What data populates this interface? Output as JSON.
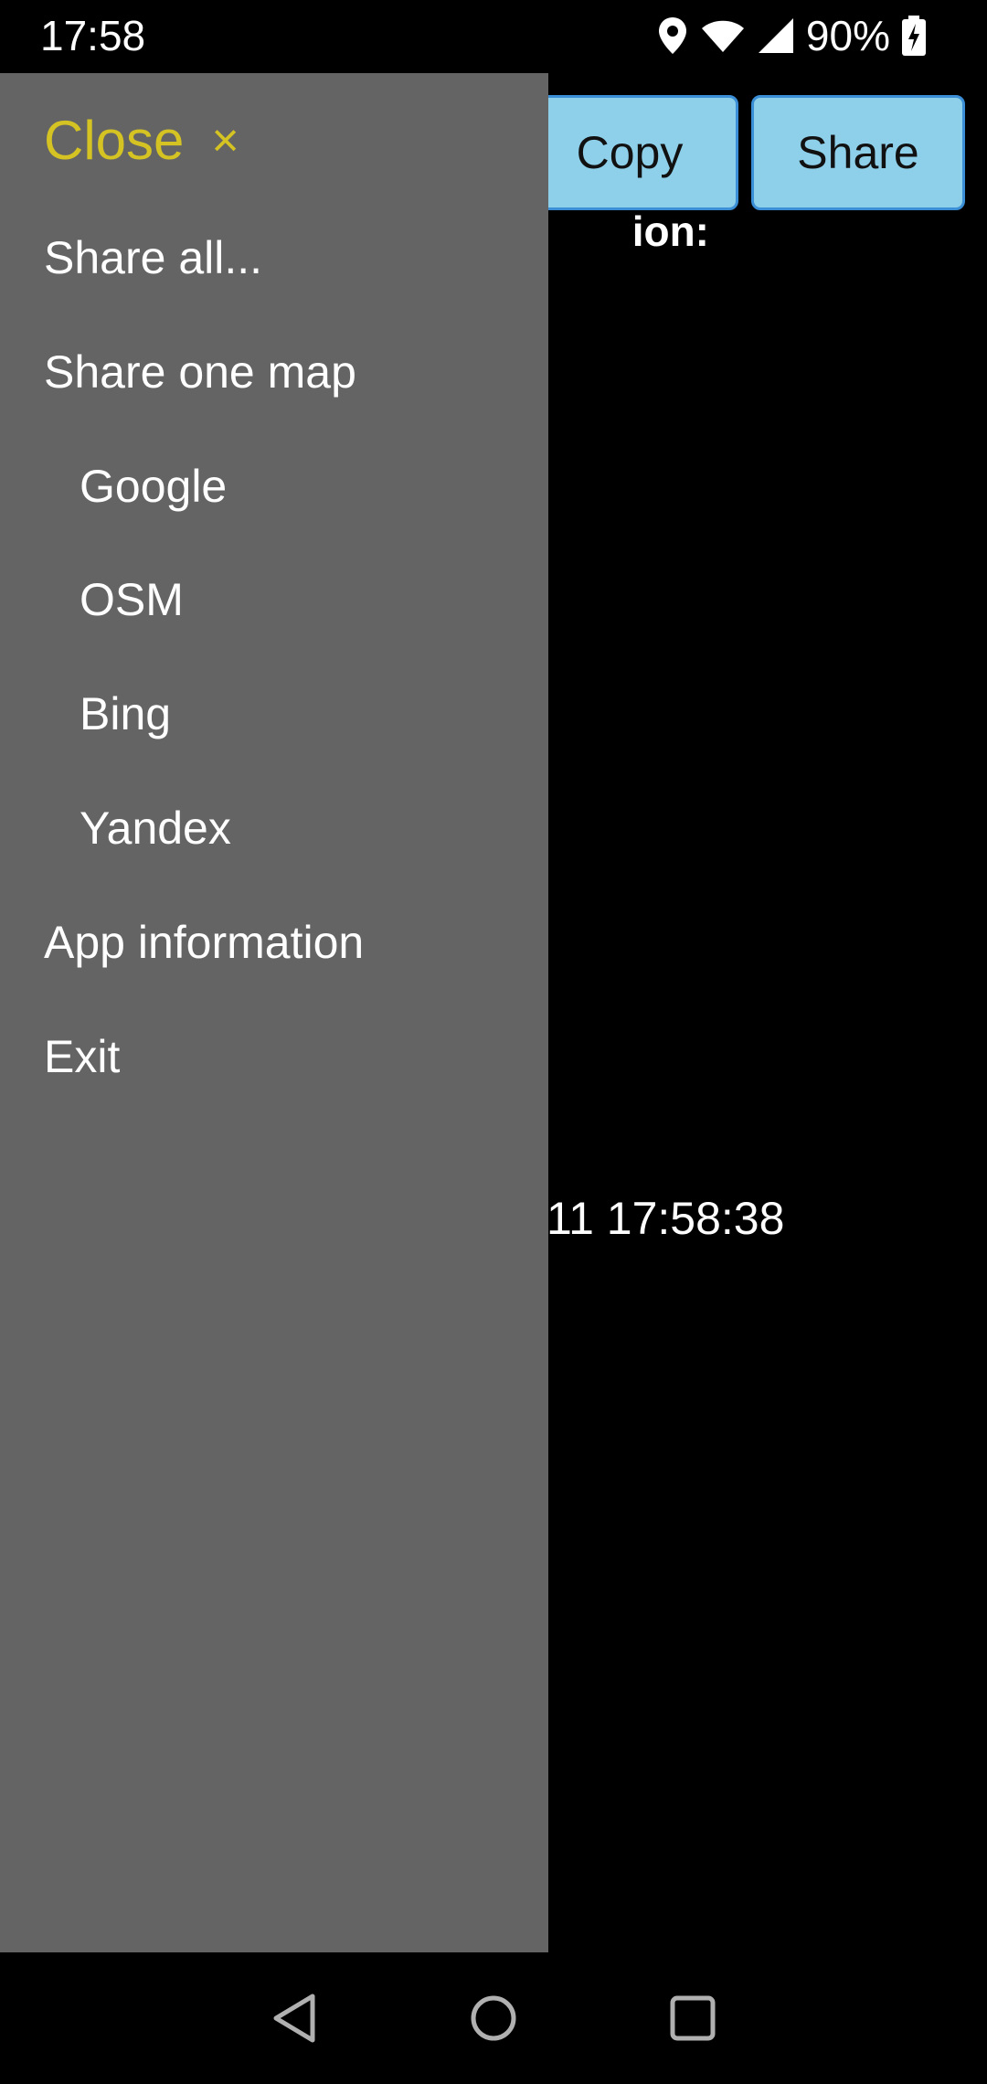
{
  "status_bar": {
    "time": "17:58",
    "battery_percent": "90%",
    "icons": [
      "location-icon",
      "wifi-icon",
      "cell-signal-icon",
      "battery-charging-icon"
    ]
  },
  "app": {
    "copy_label": "Copy",
    "share_label": "Share",
    "partial_label": "ion:",
    "partial_timestamp": "11 17:58:38"
  },
  "drawer": {
    "close_label": "Close",
    "close_icon": "×",
    "items": [
      {
        "label": "Share all..."
      },
      {
        "label": "Share one map"
      },
      {
        "label": "Google"
      },
      {
        "label": "OSM"
      },
      {
        "label": "Bing"
      },
      {
        "label": "Yandex"
      },
      {
        "label": "App information"
      },
      {
        "label": "Exit"
      }
    ]
  },
  "nav_bar": {
    "icons": [
      "back-icon",
      "home-icon",
      "recents-icon"
    ]
  },
  "colors": {
    "drawer_bg": "#646464",
    "accent_yellow": "#d4c322",
    "button_bg": "#8ecfe9",
    "button_border": "#3a8fd6"
  }
}
